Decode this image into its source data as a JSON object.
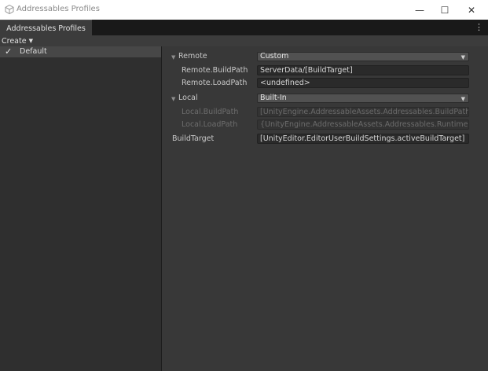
{
  "window": {
    "title": "Addressables Profiles",
    "minimize_glyph": "—",
    "maximize_glyph": "☐",
    "close_glyph": "✕"
  },
  "tabs": [
    {
      "label": "Addressables Profiles",
      "active": true
    }
  ],
  "tabbar": {
    "menu_glyph": "⋮"
  },
  "toolbar": {
    "create_label": "Create",
    "create_caret": "▼"
  },
  "profiles": [
    {
      "name": "Default",
      "selected": true,
      "check_glyph": "✓"
    }
  ],
  "settings": {
    "remote": {
      "label": "Remote",
      "arrow": "▼",
      "mode": "Custom",
      "build_path_label": "Remote.BuildPath",
      "build_path_value": "ServerData/[BuildTarget]",
      "load_path_label": "Remote.LoadPath",
      "load_path_value": "<undefined>"
    },
    "local": {
      "label": "Local",
      "arrow": "▼",
      "mode": "Built-In",
      "build_path_label": "Local.BuildPath",
      "build_path_value": "[UnityEngine.AddressableAssets.Addressables.BuildPath]/[BuildTarget]",
      "load_path_label": "Local.LoadPath",
      "load_path_value": "{UnityEngine.AddressableAssets.Addressables.RuntimePath}/[BuildTarget]"
    },
    "build_target": {
      "label": "BuildTarget",
      "value": "[UnityEditor.EditorUserBuildSettings.activeBuildTarget]"
    },
    "dropdown_caret": "▼"
  },
  "colors": {
    "background": "#383838",
    "left_panel": "#2f2f2f",
    "selected_row": "#474747",
    "field_bg": "#2a2a2a",
    "dropdown_bg": "#515151"
  }
}
